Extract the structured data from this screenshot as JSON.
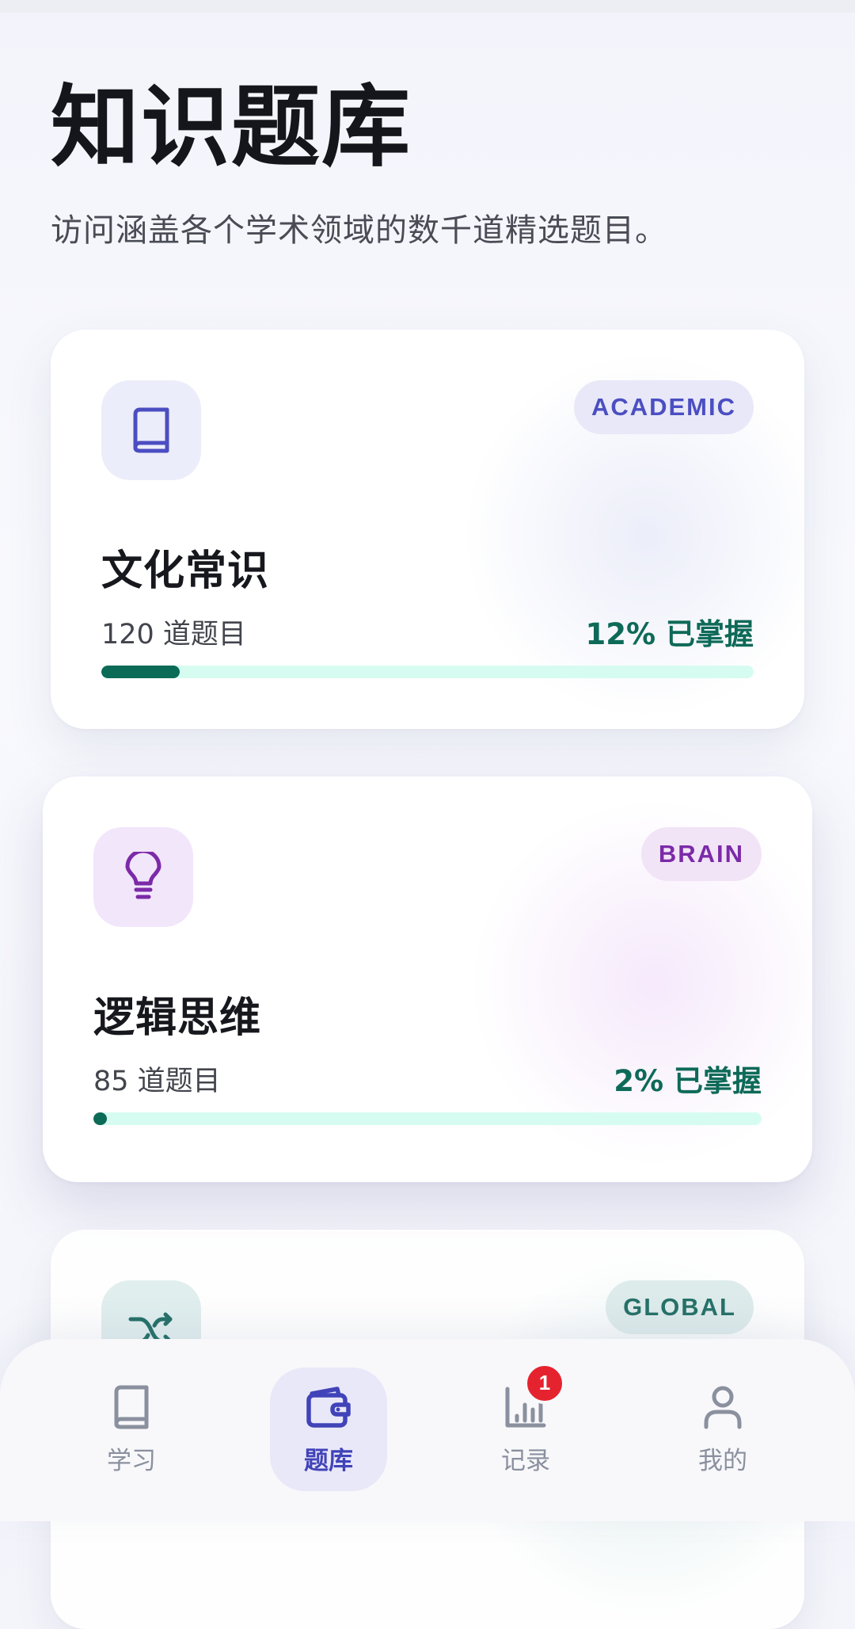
{
  "page": {
    "title": "知识题库",
    "subtitle": "访问涵盖各个学术领域的数千道精选题目。"
  },
  "cards": [
    {
      "icon": "book-icon",
      "tag": "ACADEMIC",
      "title": "文化常识",
      "count": "120 道题目",
      "mastery": "12% 已掌握",
      "progress": 0.12,
      "accent": "#4b4ec1"
    },
    {
      "icon": "lightbulb-icon",
      "tag": "BRAIN",
      "title": "逻辑思维",
      "count": "85 道题目",
      "mastery": "2% 已掌握",
      "progress": 0.02,
      "accent": "#7b2aa8"
    },
    {
      "icon": "shuffle-icon",
      "tag": "GLOBAL"
    }
  ],
  "colors": {
    "progress_fill": "#0b6b57",
    "progress_track": "#d6fcf1",
    "nav_active": "#4143b9",
    "badge": "#e5232f"
  },
  "nav": {
    "items": [
      {
        "label": "学习",
        "icon": "book-icon",
        "active": false
      },
      {
        "label": "题库",
        "icon": "wallet-icon",
        "active": true
      },
      {
        "label": "记录",
        "icon": "bar-chart-icon",
        "active": false,
        "badge": "1"
      },
      {
        "label": "我的",
        "icon": "person-icon",
        "active": false
      }
    ]
  }
}
